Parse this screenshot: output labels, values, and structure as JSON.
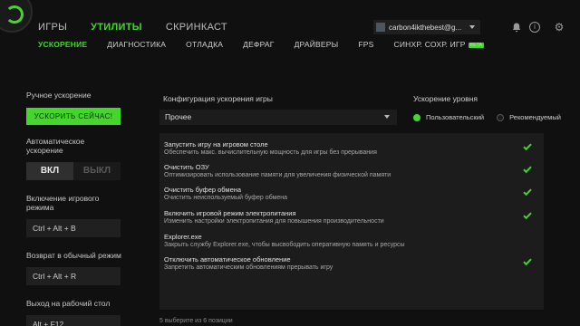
{
  "topnav": {
    "items": [
      "ИГРЫ",
      "УТИЛИТЫ",
      "СКРИНКАСТ"
    ],
    "active": "УТИЛИТЫ"
  },
  "subnav": {
    "items": [
      "УСКОРЕНИЕ",
      "ДИАГНОСТИКА",
      "ОТЛАДКА",
      "ДЕФРАГ",
      "ДРАЙВЕРЫ",
      "FPS",
      "СИНХР. СОХР. ИГР"
    ],
    "beta_badge": "BETA"
  },
  "account": {
    "name": "carbon4ikthebest@g..."
  },
  "icons": {
    "bell": "bell-icon",
    "info": "info-icon",
    "gear": "gear-icon"
  },
  "colors": {
    "accent": "#44d62c",
    "background": "#101010",
    "panel": "#1c1c1c"
  },
  "left": {
    "manual_label": "Ручное ускорение",
    "boost_button": "УСКОРИТЬ СЕЙЧАС!",
    "auto_label": "Автоматическое ускорение",
    "toggle_on": "ВКЛ",
    "toggle_off": "ВЫКЛ",
    "game_mode_label": "Включение игрового режима",
    "game_mode_keys": "Ctrl + Alt + B",
    "normal_mode_label": "Возврат в обычный режим",
    "normal_mode_keys": "Ctrl + Alt + R",
    "desktop_label": "Выход на рабочий стол",
    "desktop_keys": "Alt + F12"
  },
  "config": {
    "title": "Конфигурация ускорения игры",
    "selected": "Прочее"
  },
  "level": {
    "title": "Ускорение уровня",
    "option_custom": "Пользовательский",
    "option_recommended": "Рекомендуемый",
    "selected": "Пользовательский"
  },
  "items": [
    {
      "title": "Запустить игру на игровом столе",
      "desc": "Обеспечить макс. вычислительную мощность для игры без прерывания",
      "checked": true
    },
    {
      "title": "Очистить ОЗУ",
      "desc": "Оптимизировать использование памяти для увеличения физической памяти",
      "checked": true
    },
    {
      "title": "Очистить буфер обмена",
      "desc": "Очистить неиспользуемый буфер обмена",
      "checked": true
    },
    {
      "title": "Включить игровой режим электропитания",
      "desc": "Изменить настройки электропитания для повышения производительности",
      "checked": true
    },
    {
      "title": "Explorer.exe",
      "desc": "Закрыть службу Explorer.exe, чтобы высвободить оперативную память и ресурсы",
      "checked": false
    },
    {
      "title": "Отключить автоматическое обновление",
      "desc": "Запретить автоматическим обновлениям прерывать игру",
      "checked": true
    }
  ],
  "footer": "5 выберите из 6 позиции"
}
